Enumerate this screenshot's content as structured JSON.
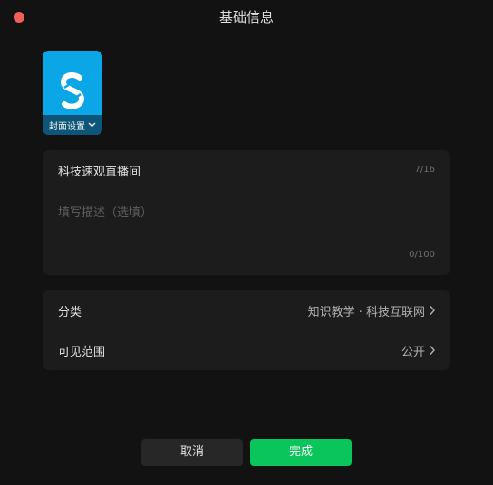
{
  "window": {
    "title": "基础信息"
  },
  "cover": {
    "label": "封面设置"
  },
  "info": {
    "title_value": "科技速观直播间",
    "title_counter": "7/16",
    "desc_placeholder": "填写描述（选填）",
    "desc_counter": "0/100"
  },
  "meta": {
    "category_label": "分类",
    "category_value": "知识教学 · 科技互联网",
    "visibility_label": "可见范围",
    "visibility_value": "公开"
  },
  "buttons": {
    "cancel_label": "取消",
    "done_label": "完成"
  },
  "colors": {
    "accent": "#0ac45c",
    "close": "#f25f58",
    "cover_bg": "#0ba6e5"
  }
}
